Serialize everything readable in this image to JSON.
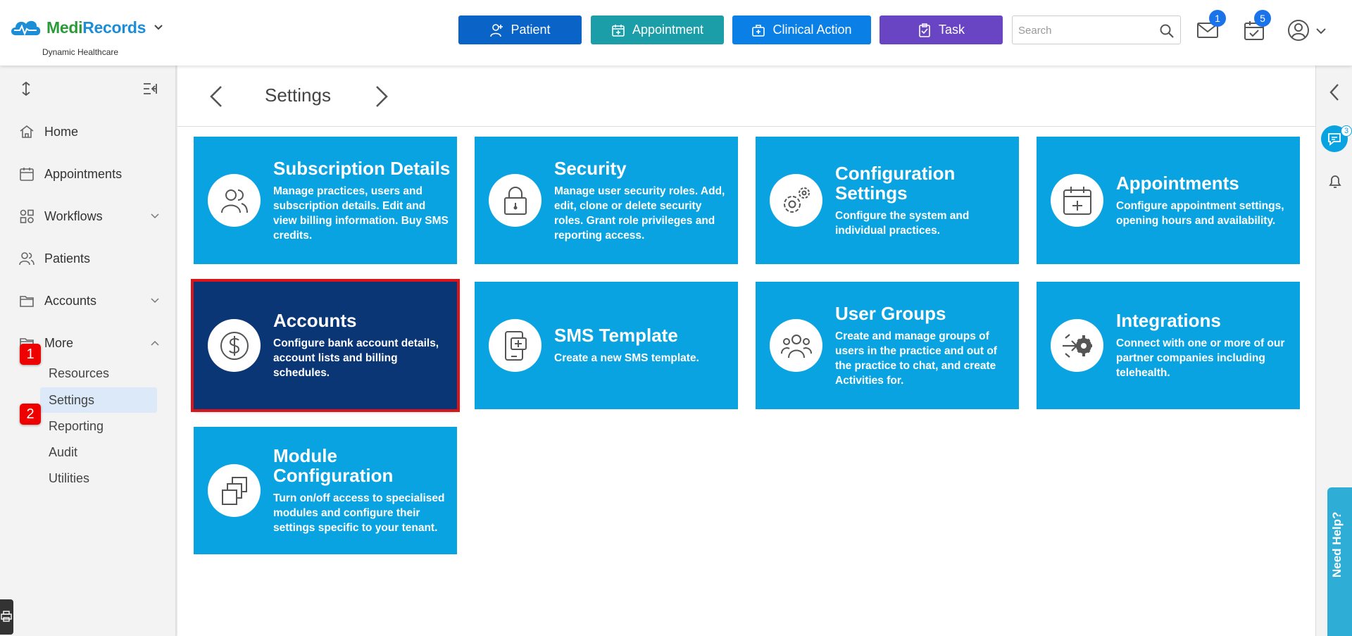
{
  "header": {
    "logo_medi": "Medi",
    "logo_records": "Records",
    "logo_subtitle": "Dynamic Healthcare",
    "buttons": {
      "patient": "Patient",
      "appointment": "Appointment",
      "clinical_action": "Clinical Action",
      "task": "Task"
    },
    "search_placeholder": "Search",
    "mail_badge": "1",
    "calendar_badge": "5"
  },
  "sidebar": {
    "items": [
      {
        "label": "Home",
        "icon": "home-icon"
      },
      {
        "label": "Appointments",
        "icon": "calendar-icon"
      },
      {
        "label": "Workflows",
        "icon": "workflow-icon"
      },
      {
        "label": "Patients",
        "icon": "people-icon"
      },
      {
        "label": "Accounts",
        "icon": "folder-icon"
      },
      {
        "label": "More",
        "icon": "folder-open-icon"
      }
    ],
    "more_subitems": [
      "Resources",
      "Settings",
      "Reporting",
      "Audit",
      "Utilities"
    ],
    "active_subitem": "Settings",
    "steps": [
      "1",
      "2"
    ]
  },
  "main": {
    "page_title": "Settings",
    "cards": [
      {
        "title": "Subscription Details",
        "desc": "Manage practices, users and subscription details. Edit and view billing information. Buy SMS credits.",
        "icon": "users-icon"
      },
      {
        "title": "Security",
        "desc": "Manage user security roles. Add, edit, clone or delete security roles. Grant role privileges and reporting access.",
        "icon": "lock-icon"
      },
      {
        "title": "Configuration Settings",
        "desc": "Configure the system and individual practices.",
        "icon": "gears-icon"
      },
      {
        "title": "Appointments",
        "desc": "Configure appointment settings, opening hours and availability.",
        "icon": "calendar-add-icon"
      },
      {
        "title": "Accounts",
        "desc": "Configure bank account details, account lists and billing schedules.",
        "icon": "dollar-icon"
      },
      {
        "title": "SMS Template",
        "desc": "Create a new SMS template.",
        "icon": "phone-message-icon"
      },
      {
        "title": "User Groups",
        "desc": "Create and manage groups of users in the practice and out of the practice to chat, and create Activities for.",
        "icon": "user-group-icon"
      },
      {
        "title": "Integrations",
        "desc": "Connect with one or more of our partner companies including telehealth.",
        "icon": "integration-icon"
      },
      {
        "title": "Module Configuration",
        "desc": "Turn on/off access to specialised modules and configure their settings specific to your tenant.",
        "icon": "modules-icon"
      }
    ],
    "selected_card": "Accounts"
  },
  "rail": {
    "chat_badge": "3",
    "need_help": "Need Help?"
  },
  "colors": {
    "card": "#0aa3e2",
    "card_selected": "#0a3675",
    "highlight": "#d9141a",
    "patient_button": "#0a64c8",
    "appointment_button": "#1b9ea8",
    "clinical_button": "#0a7fe6",
    "task_button": "#6a45c3"
  }
}
